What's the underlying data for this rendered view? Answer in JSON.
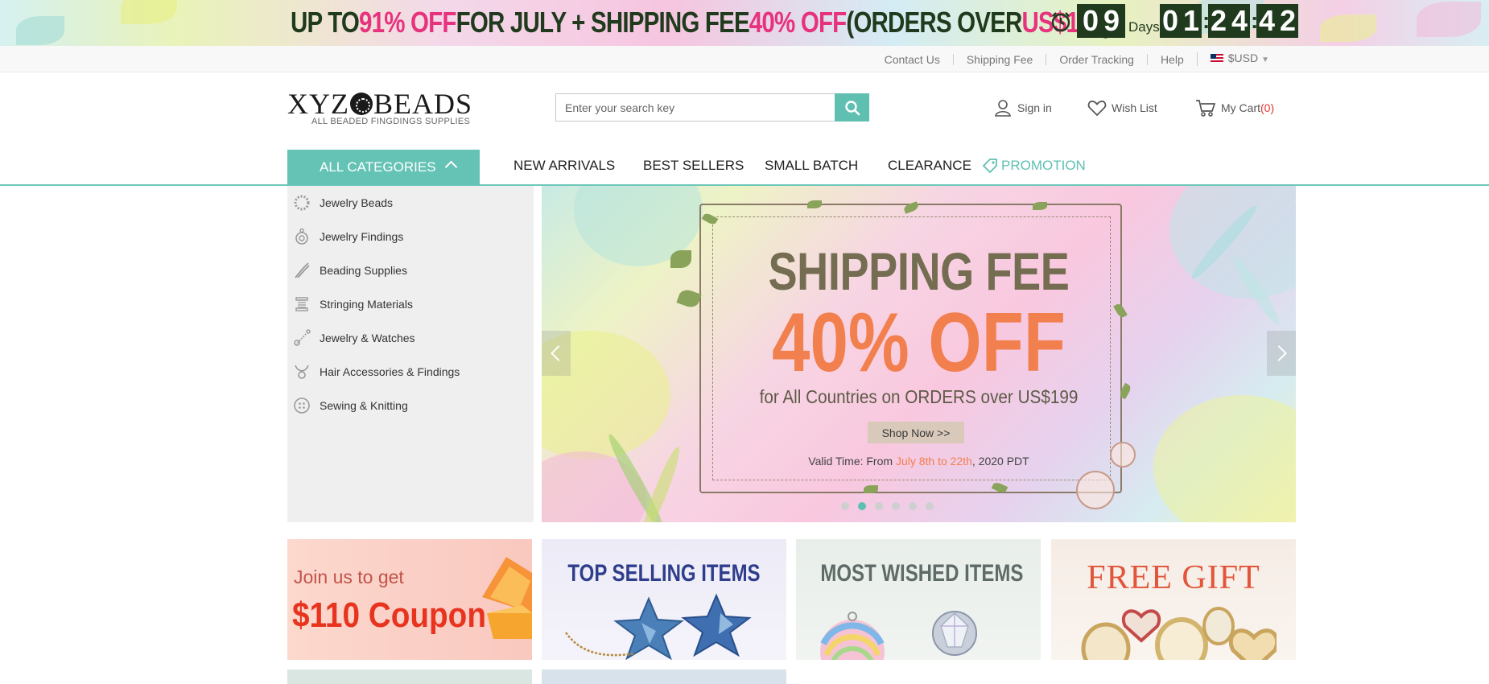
{
  "promo": {
    "part1": "UP TO ",
    "discount": "91% OFF",
    "part2": " FOR JULY + SHIPPING FEE ",
    "shipping_discount": "40% OFF",
    "part3": "(ORDERS OVER ",
    "threshold": "US$199",
    "part4": ")",
    "countdown": {
      "days": "09",
      "days_label": "Days",
      "hours": "01",
      "minutes": "24",
      "seconds": "42"
    }
  },
  "utility": {
    "links": [
      "Contact Us",
      "Shipping Fee",
      "Order Tracking",
      "Help"
    ],
    "currency": "$USD"
  },
  "header": {
    "logo_text_left": "XYZ",
    "logo_text_right": "BEADS",
    "logo_tagline": "ALL BEADED FINGDINGS SUPPLIES",
    "search_placeholder": "Enter your search key",
    "sign_in": "Sign in",
    "wish_list": "Wish List",
    "cart_label": "My Cart",
    "cart_count": "(0)"
  },
  "nav": {
    "all_categories": "ALL CATEGORIES",
    "items": [
      "NEW ARRIVALS",
      "BEST SELLERS",
      "SMALL BATCH",
      "CLEARANCE"
    ],
    "promotion": "PROMOTION"
  },
  "categories": [
    "Jewelry Beads",
    "Jewelry Findings",
    "Beading Supplies",
    "Stringing Materials",
    "Jewelry & Watches",
    "Hair Accessories & Findings",
    "Sewing & Knitting"
  ],
  "hero": {
    "title": "SHIPPING FEE",
    "discount": "40% OFF",
    "subtitle": "for All Countries on ORDERS over US$199",
    "button": "Shop Now >>",
    "valid_prefix": "Valid Time: From ",
    "valid_dates": "July 8th to 22th",
    "valid_suffix": ", 2020 PDT",
    "slide_count": 6,
    "active_slide": 2
  },
  "tiles": {
    "coupon_join": "Join us to get",
    "coupon_amount": "$110 Coupon",
    "top_selling": "TOP SELLING ITEMS",
    "most_wished": "MOST WISHED ITEMS",
    "free_gift": "FREE GIFT"
  },
  "colors": {
    "accent": "#5fc0b2",
    "promo_pink": "#e7337e",
    "promo_dark": "#1f3a1c",
    "hero_orange": "#f27f4e",
    "cart_red": "#e0342c"
  }
}
